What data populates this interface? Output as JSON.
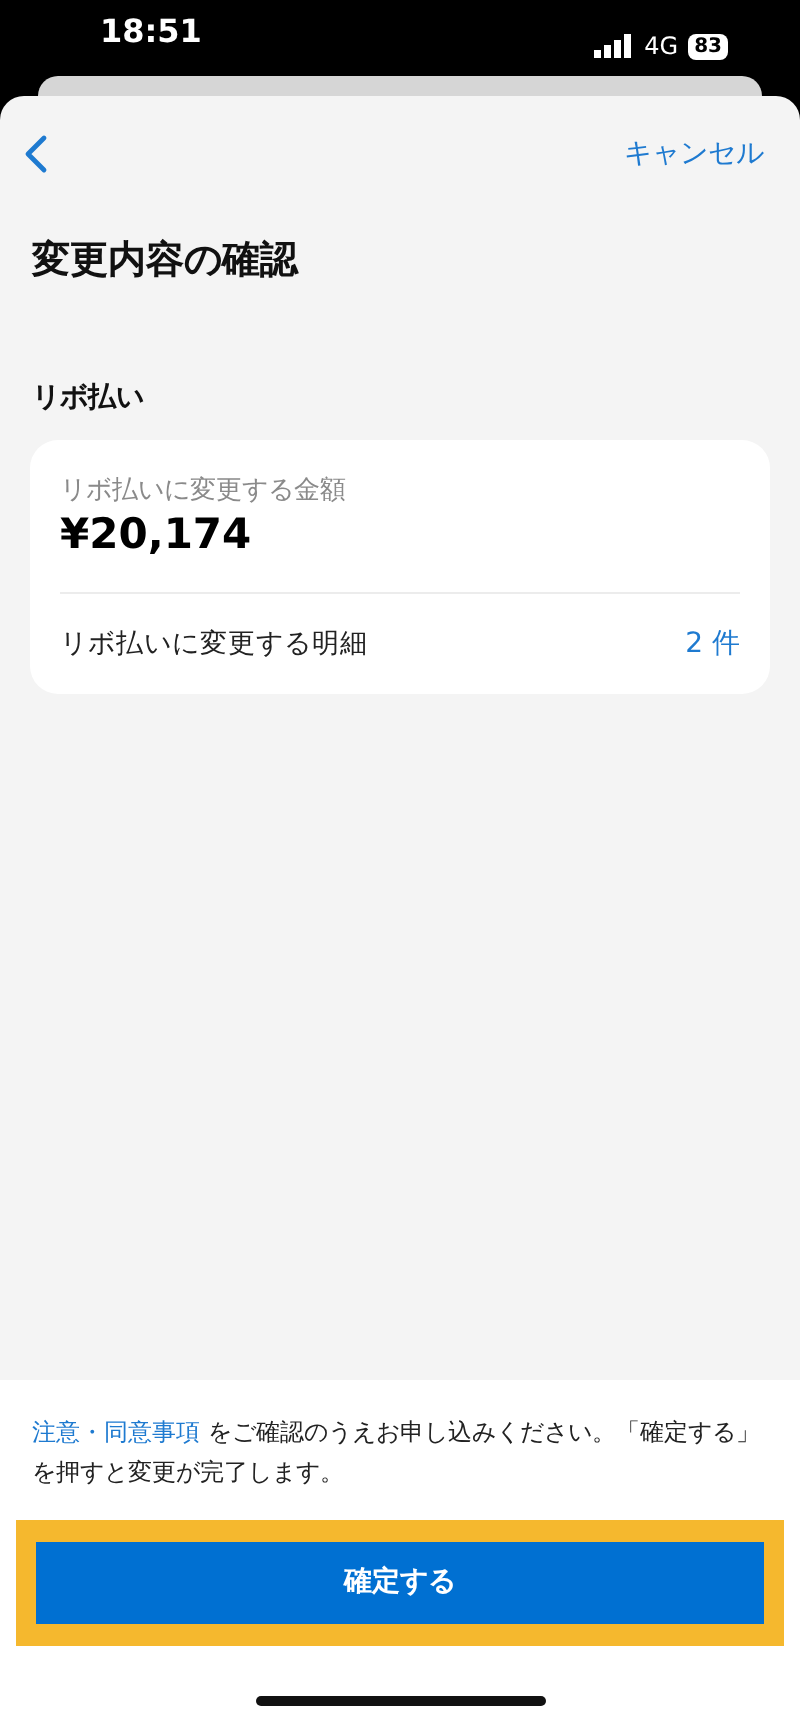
{
  "status_bar": {
    "time": "18:51",
    "network": "4G",
    "battery": "83"
  },
  "nav": {
    "cancel": "キャンセル"
  },
  "title": "変更内容の確認",
  "section": {
    "label": "リボ払い",
    "amount_label": "リボ払いに変更する金額",
    "amount": "¥20,174",
    "details_label": "リボ払いに変更する明細",
    "details_count": "2 件"
  },
  "notice": {
    "link": "注意・同意事項",
    "text": " をご確認のうえお申し込みください。「確定する」を押すと変更が完了します。"
  },
  "confirm_button": {
    "label": "確定する",
    "highlighted": true
  }
}
